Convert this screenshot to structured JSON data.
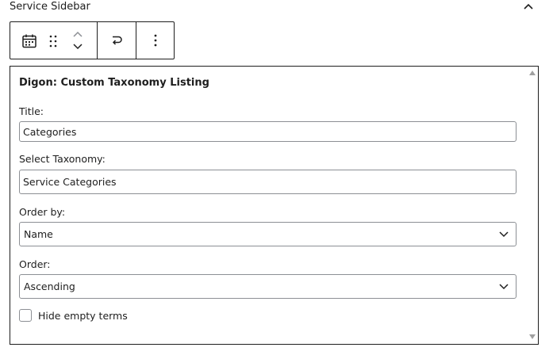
{
  "panel": {
    "title": "Service Sidebar"
  },
  "toolbar": {
    "block_icon": "calendar-icon",
    "drag_icon": "drag-handle-icon",
    "move_up_icon": "chevron-up-icon",
    "move_down_icon": "chevron-down-icon",
    "transform_icon": "transform-icon",
    "options_icon": "more-vertical-icon"
  },
  "widget": {
    "title": "Digon: Custom Taxonomy Listing",
    "fields": {
      "title_label": "Title:",
      "title_value": "Categories",
      "taxonomy_label": "Select Taxonomy:",
      "taxonomy_value": "Service Categories",
      "order_by_label": "Order by:",
      "order_by_value": "Name",
      "order_label": "Order:",
      "order_value": "Ascending",
      "hide_empty_label": "Hide empty terms"
    }
  }
}
